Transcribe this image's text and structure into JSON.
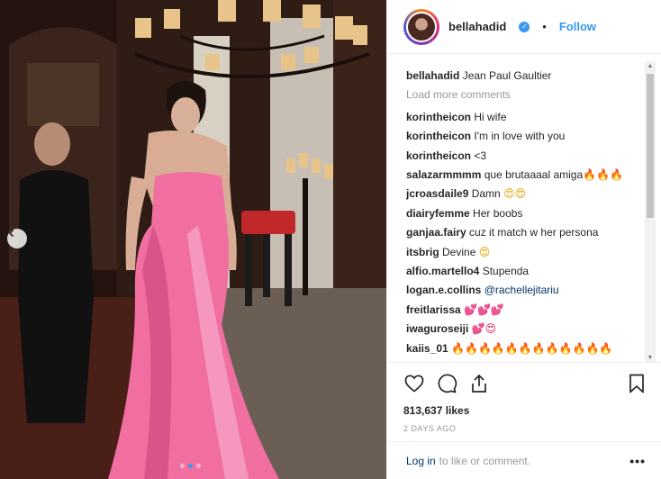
{
  "post_header": {
    "username": "bellahadid",
    "follow_label": "Follow",
    "separator": "•"
  },
  "caption": {
    "username": "bellahadid",
    "text": "Jean Paul Gaultier"
  },
  "load_more_label": "Load more comments",
  "comments": [
    {
      "user": "korintheicon",
      "text": "Hi wife"
    },
    {
      "user": "korintheicon",
      "text": "I'm in love with you"
    },
    {
      "user": "korintheicon",
      "text": "<3"
    },
    {
      "user": "salazarmmmm",
      "text": "que brutaaaal amiga",
      "emoji": "🔥🔥🔥",
      "emoji_kind": "fire"
    },
    {
      "user": "jcroasdaile9",
      "text": "Damn",
      "emoji": "😍😍",
      "emoji_kind": "face"
    },
    {
      "user": "diairyfemme",
      "text": "Her boobs"
    },
    {
      "user": "ganjaa.fairy",
      "text": "cuz it match w her persona"
    },
    {
      "user": "itsbrig",
      "text": "Devine",
      "emoji": "😍",
      "emoji_kind": "face"
    },
    {
      "user": "alfio.martello4",
      "text": "Stupenda"
    },
    {
      "user": "logan.e.collins",
      "mention": "@rachellejitariu"
    },
    {
      "user": "freitlarissa",
      "text": "",
      "emoji": "💕💕💕",
      "emoji_kind": "heart"
    },
    {
      "user": "iwaguroseiji",
      "text": "",
      "emoji": "💕😍",
      "emoji_kind": "heart"
    },
    {
      "user": "kaiis_01",
      "text": "",
      "emoji": "🔥🔥🔥🔥🔥🔥🔥🔥🔥🔥🔥🔥",
      "emoji_kind": "fire"
    }
  ],
  "likes_label": "813,637 likes",
  "timestamp": "2 DAYS AGO",
  "login_bar": {
    "link": "Log in",
    "text": "to like or comment.",
    "more": "•••"
  },
  "icons": {
    "verified": "verified-badge-icon",
    "like": "heart-icon",
    "comment": "comment-bubble-icon",
    "share": "share-upload-icon",
    "save": "bookmark-icon",
    "prev": "chevron-left-icon"
  },
  "carousel": {
    "count": 3,
    "active": 1
  },
  "colors": {
    "accent": "#3897f0",
    "dress": "#f06fa0"
  }
}
